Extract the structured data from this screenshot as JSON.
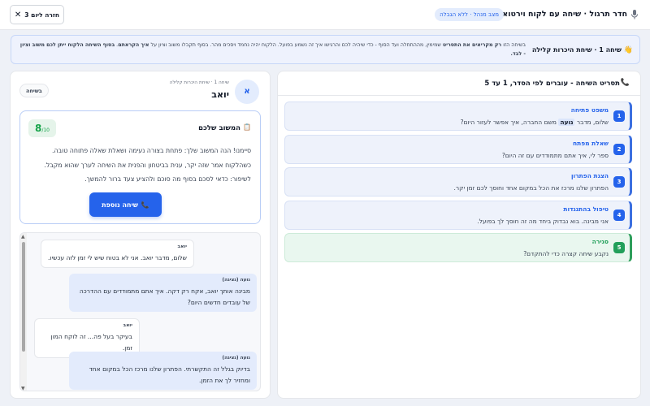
{
  "header": {
    "title": "חדר תרגול · שיחה עם לקוח וירטואלי",
    "mode_badge": "מצב מנהל · ללא הגבלה",
    "back_button": "חזרה ליום 3"
  },
  "notice": {
    "title": "שיחה 1 · שיחת היכרות קלילה",
    "text_1": "בשיחה הזו ",
    "text_1_bold": "רק מקריאים את התסריט",
    "text_2": " שמימין, מההתחלה ועד הסוף - כדי שיהיה לכם והרגישו איך זה נשמע בפועל. הלקוח יהיה נחמד ויסכים מהר. בסוף תקבלו משוב וציון על ",
    "text_2_bold": "איך הקראתם",
    "text_3": ". ",
    "text_3_bold": "בסוף השיחה הלקוח ייתן לכם משוב וציון - לבד."
  },
  "script": {
    "title": "תסריט השיחה - עוברים לפי הסדר, 1 עד 5",
    "steps": [
      {
        "num": "1",
        "title": "משפט פתיחה",
        "text_before": "שלום, מדבר ",
        "highlight": "נועה",
        "text_after": " משם החברה, איך אפשר לעזור היום?"
      },
      {
        "num": "2",
        "title": "שאלת מפתח",
        "text": "ספר לי, איך אתם מתמודדים עם זה היום?"
      },
      {
        "num": "3",
        "title": "הצגת הפתרון",
        "text": "הפתרון שלנו מרכז את הכל במקום אחד וחוסך לכם זמן יקר."
      },
      {
        "num": "4",
        "title": "טיפול בהתנגדות",
        "text": "אני מבינה. בוא נבדוק ביחד מה זה חוסך לך בפועל."
      },
      {
        "num": "5",
        "title": "סגירה",
        "text": "נקבע שיחה קצרה כדי להתקדם?"
      }
    ]
  },
  "customer": {
    "avatar_letter": "א",
    "caption": "שיחה 1 · שיחת היכרות קלילה",
    "name": "יואב",
    "status": "בשיחה"
  },
  "feedback": {
    "title": "המשוב שלכם",
    "score": "8",
    "score_max": "/10",
    "line_1": "סיימנו! הנה המשוב שלך: פתחת בצורה נעימה ושאלת שאלה פתוחה טובה.",
    "line_2": "כשהלקוח אמר שזה יקר, ענית בביטחון והפנית את השיחה לערך שהוא מקבל.",
    "line_3": "לשיפור: כדאי לסכם בסוף מה סוכם ולהציע צעד ברור להמשך.",
    "another_button": "שיחה נוספת"
  },
  "chat": {
    "messages": [
      {
        "who": "יואב",
        "text": "שלום, מדבר יואב. אני לא בטוח שיש לי זמן לזה עכשיו.",
        "role": "customer"
      },
      {
        "who": "נועה (נציגה)",
        "text": "מבינה אותך יואב, אקח רק דקה. איך אתם מתמודדים עם ההדרכה של עובדים חדשים היום?",
        "role": "agent"
      },
      {
        "who": "יואב",
        "text": "בעיקר בעל פה... זה לוקח המון זמן.",
        "role": "customer"
      },
      {
        "who": "נועה (נציגה)",
        "text": "בדיוק בגלל זה התקשרתי. הפתרון שלנו מרכז הכל במקום אחד ומחזיר לך את הזמן.",
        "role": "agent"
      }
    ]
  }
}
